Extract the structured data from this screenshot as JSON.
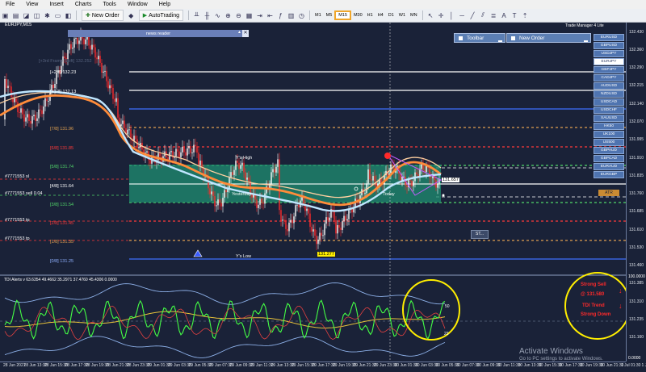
{
  "menu": [
    "File",
    "View",
    "Insert",
    "Charts",
    "Tools",
    "Window",
    "Help"
  ],
  "toolbar": {
    "new_order": "New Order",
    "autotrading": "AutoTrading",
    "timeframes": [
      "M1",
      "M5",
      "M15",
      "M30",
      "H1",
      "H4",
      "D1",
      "W1",
      "MN"
    ],
    "active_timeframe": "M15"
  },
  "chart": {
    "symbol_title": "EURJPY,M15",
    "news_reader": "news reader",
    "panels": {
      "toolbar": "Toolbar",
      "new_order": "New Order"
    },
    "trade_manager": "Trade Manager 4 Lite",
    "symbols": [
      "EURUSD",
      "GBPUSD",
      "USDJPY",
      "EURJPY",
      "GBPJPY",
      "CADJPY",
      "AUDUSD",
      "NZDUSD",
      "USDCAD",
      "USDCHF",
      "XAUUSD",
      "HK50",
      "UK100",
      "US500",
      "GBPAUD",
      "GBPCAD",
      "EURAUD",
      "EURGBP"
    ],
    "selected_symbol": "EURJPY",
    "atr_label": "ATR",
    "small_button": "ST...",
    "levels": [
      {
        "label": "[+2/8]",
        "price": "132.23"
      },
      {
        "label": "[+1/8]",
        "price": "132.13"
      },
      {
        "label": "[7/8]",
        "price": "131.96"
      },
      {
        "label": "[6/8]",
        "price": "131.85"
      },
      {
        "label": "[5/8]",
        "price": "131.74"
      },
      {
        "label": "[4/8]",
        "price": "131.64"
      },
      {
        "label": "[3/8]",
        "price": "131.54"
      },
      {
        "label": "[2/8]",
        "price": "131.45"
      },
      {
        "label": "[1/8]",
        "price": "131.35"
      },
      {
        "label": "[0/8]",
        "price": "131.25"
      }
    ],
    "faint_label": "[+3rd Frame Shift] 132.252",
    "order_labels": {
      "sl": "#7771553 sl",
      "sell": "#7771553 sell 0.04",
      "tp1": "#7771553 tp",
      "tp2": "#7771553 tp"
    },
    "ys_high": "Y's High",
    "ys_low": "Y's Low",
    "yesterday": "Yesterday",
    "today": "Today",
    "low_price_tag": "131.277",
    "current_price_tag": "131.657"
  },
  "price_axis": [
    "132.430",
    "132.360",
    "132.290",
    "132.215",
    "132.140",
    "132.070",
    "131.995",
    "131.910",
    "131.835",
    "131.760",
    "131.685",
    "131.610",
    "131.530",
    "131.460",
    "131.385",
    "131.310",
    "131.235",
    "131.160"
  ],
  "indicator": {
    "title": "TDI Alerts v 63.6354 49.4662 35.2971 37.4760 45.4306 0.0000",
    "axis_top": "100.0000",
    "axis_bottom": "0.0000",
    "level_50": "50",
    "level_23": "23",
    "signal1": "Strong Sell",
    "signal_price": "@ 131.580",
    "signal2": "TDI Trend",
    "signal3": "Strong Down"
  },
  "time_axis": [
    "28 Jun 2021",
    "28 Jun 13:30",
    "28 Jun 15:30",
    "28 Jun 17:30",
    "28 Jun 19:30",
    "28 Jun 21:30",
    "28 Jun 23:30",
    "29 Jun 01:30",
    "29 Jun 03:30",
    "29 Jun 05:30",
    "29 Jun 07:30",
    "29 Jun 09:30",
    "29 Jun 11:30",
    "29 Jun 13:30",
    "29 Jun 15:30",
    "29 Jun 17:30",
    "29 Jun 19:30",
    "29 Jun 21:30",
    "29 Jun 23:30",
    "30 Jun 01:30",
    "30 Jun 03:30",
    "30 Jun 05:30",
    "30 Jun 07:30",
    "30 Jun 09:30",
    "30 Jun 11:30",
    "30 Jun 13:30",
    "30 Jun 15:30",
    "30 Jun 17:30",
    "30 Jun 19:30",
    "30 Jun 21:30",
    "1 Jul 01:30",
    "1 Jul 05:30"
  ],
  "watermark": {
    "title": "Activate Windows",
    "sub": "Go to PC settings to activate Windows."
  },
  "colors": {
    "background": "#1a2238",
    "up_candle": "#ffffff",
    "down_candle": "#ff2a2a",
    "zone": "#1f8f72",
    "ma_orange": "#ff8c3a",
    "ma_light": "#bfe6ff",
    "signal": "#ff2a2a",
    "highlight": "#ffee00",
    "tdi_green": "#44ff44",
    "tdi_yellow": "#e6c13a"
  }
}
